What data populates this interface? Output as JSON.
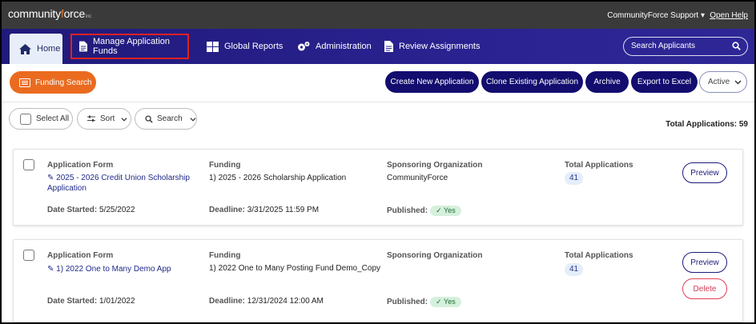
{
  "topbar": {
    "logo_pre": "community",
    "logo_o": "f",
    "logo_post": "orce",
    "logo_sup": "inc",
    "support": "CommunityForce Support",
    "help": "Open Help"
  },
  "nav": {
    "home": "Home",
    "funds": "Manage Application Funds",
    "reports": "Global Reports",
    "admin": "Administration",
    "review": "Review Assignments",
    "search_placeholder": "Search Applicants"
  },
  "toolbar": {
    "funding_search": "Funding Search",
    "create": "Create New Application",
    "clone": "Clone Existing Application",
    "archive": "Archive",
    "export": "Export to Excel",
    "status": "Active"
  },
  "filters": {
    "select_all": "Select All",
    "sort": "Sort",
    "search": "Search",
    "total_label": "Total Applications: 59"
  },
  "labels": {
    "app_form": "Application Form",
    "funding": "Funding",
    "sponsor": "Sponsoring Organization",
    "total_apps": "Total Applications",
    "date_started": "Date Started:",
    "deadline": "Deadline:",
    "published": "Published:",
    "yes": "Yes",
    "preview": "Preview",
    "delete": "Delete"
  },
  "cards": [
    {
      "form_line1": "2025 - 2026 Credit Union Scholarship",
      "form_line2": "Application",
      "funding": "1) 2025 - 2026 Scholarship Application",
      "sponsor": "CommunityForce",
      "total": "41",
      "date_started": "5/25/2022",
      "deadline": "3/31/2025 11:59 PM"
    },
    {
      "form_line1": "1) 2022 One to Many Demo App",
      "form_line2": "",
      "funding": "1) 2022 One to Many Posting Fund Demo_Copy",
      "sponsor": "",
      "total": "41",
      "date_started": "1/01/2022",
      "deadline": "12/31/2024 12:00 AM"
    }
  ],
  "colors": {
    "nav_bg": "#241d84",
    "primary": "#120d6e",
    "accent_orange": "#ea6b1f",
    "highlight_red": "#e02020"
  }
}
